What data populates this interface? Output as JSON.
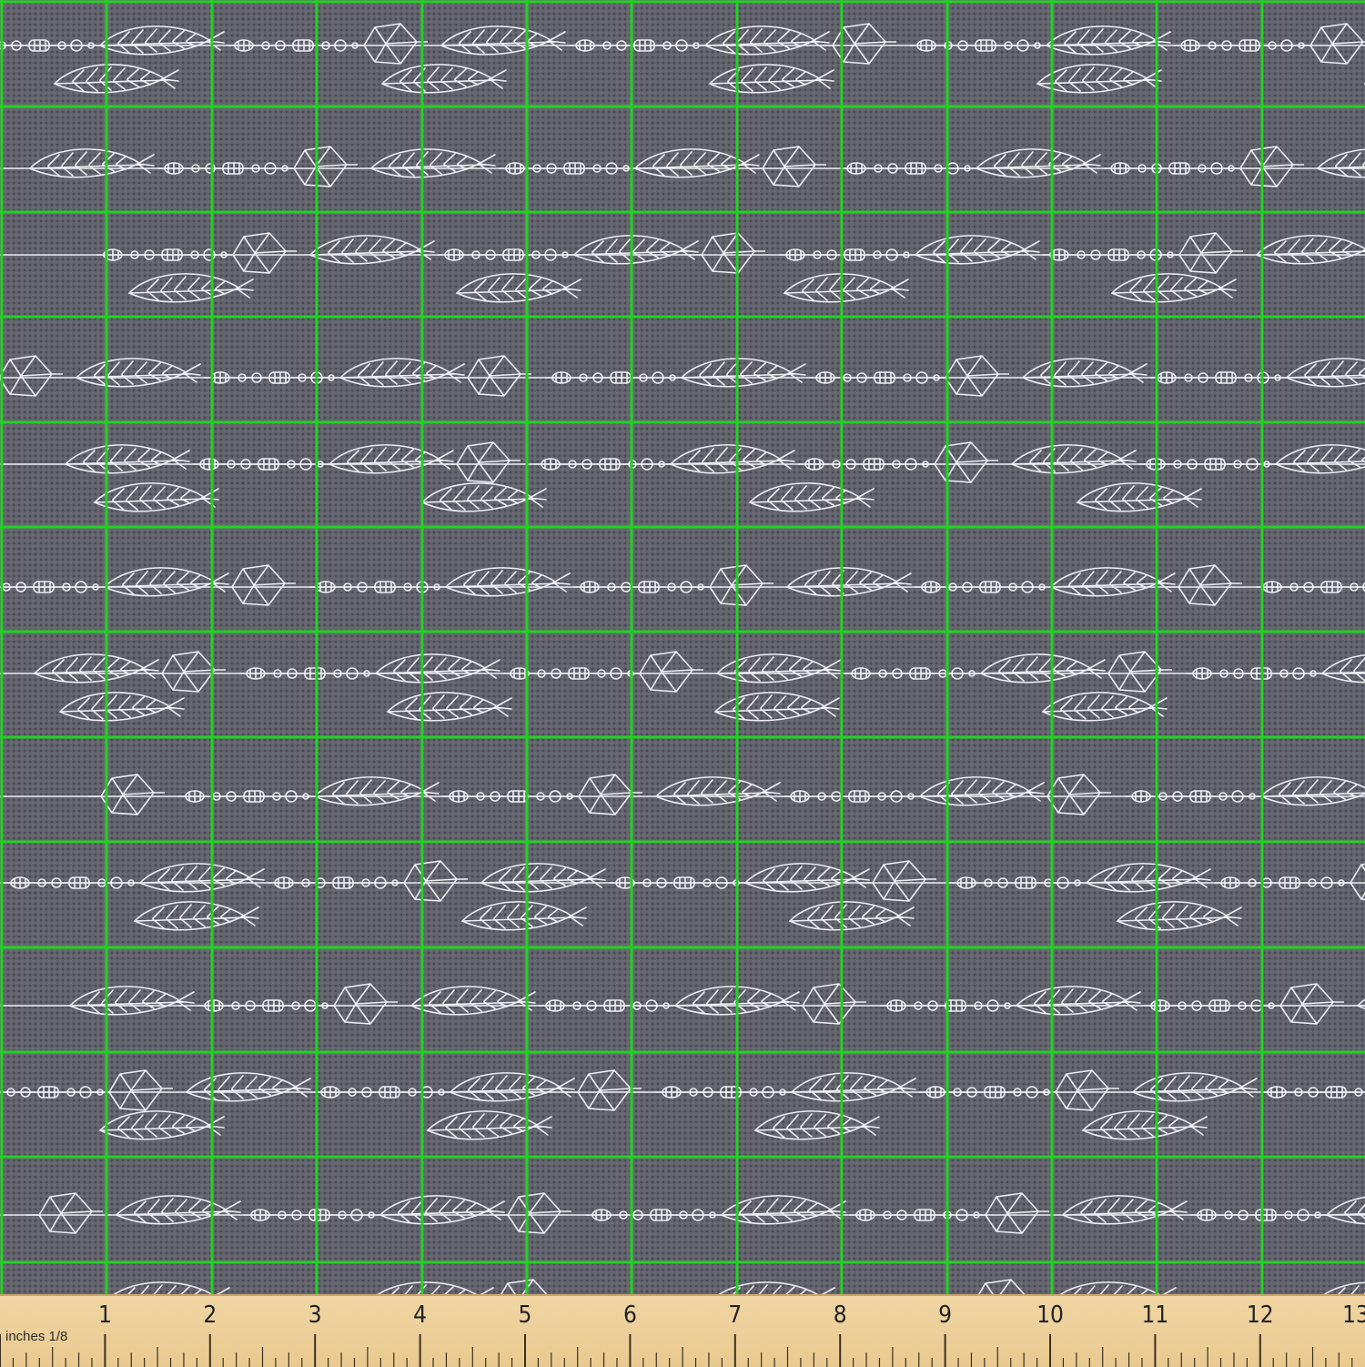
{
  "image": {
    "subject": "fabric-swatch",
    "background_color": "#64646f",
    "motif_color": "#eeeef4",
    "grid_color": "#1fd41f"
  },
  "motif": {
    "icons": [
      "feather-icon",
      "crystal-icon",
      "bead-icon",
      "string-line-icon"
    ]
  },
  "ruler": {
    "unit_label": "inches 1/8",
    "numbers": [
      "1",
      "2",
      "3",
      "4",
      "5",
      "6",
      "7",
      "8",
      "9",
      "10",
      "11",
      "12",
      "13"
    ]
  }
}
